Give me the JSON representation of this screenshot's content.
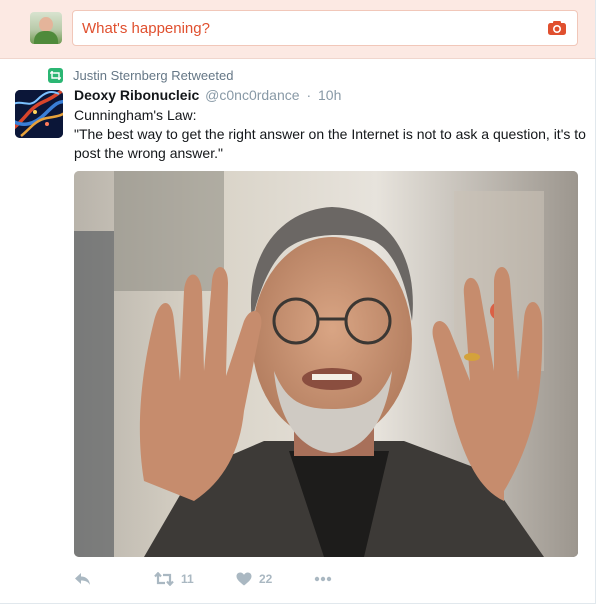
{
  "compose": {
    "placeholder": "What's happening?",
    "avatar_icon": "user-avatar",
    "camera_icon": "camera-icon",
    "accent": "#e0502f"
  },
  "tweet": {
    "retweet_context": "Justin Sternberg Retweeted",
    "author": {
      "display_name": "Deoxy Ribonucleic",
      "screen_name": "@c0nc0rdance",
      "separator": "·",
      "timestamp": "10h"
    },
    "text_line1": "Cunningham's Law:",
    "text_line2": "\"The best way to get the right answer on the Internet is not to ask a question, it's to post the wrong answer.\"",
    "media_icon": "photo-man-gesturing",
    "actions": {
      "reply_icon": "reply-icon",
      "retweet_icon": "retweet-icon",
      "retweet_count": "11",
      "like_icon": "heart-icon",
      "like_count": "22",
      "more_icon": "more-icon"
    },
    "colors": {
      "retweet_badge": "#2bb673",
      "muted": "#8899a6",
      "action": "#aab8c2"
    }
  }
}
